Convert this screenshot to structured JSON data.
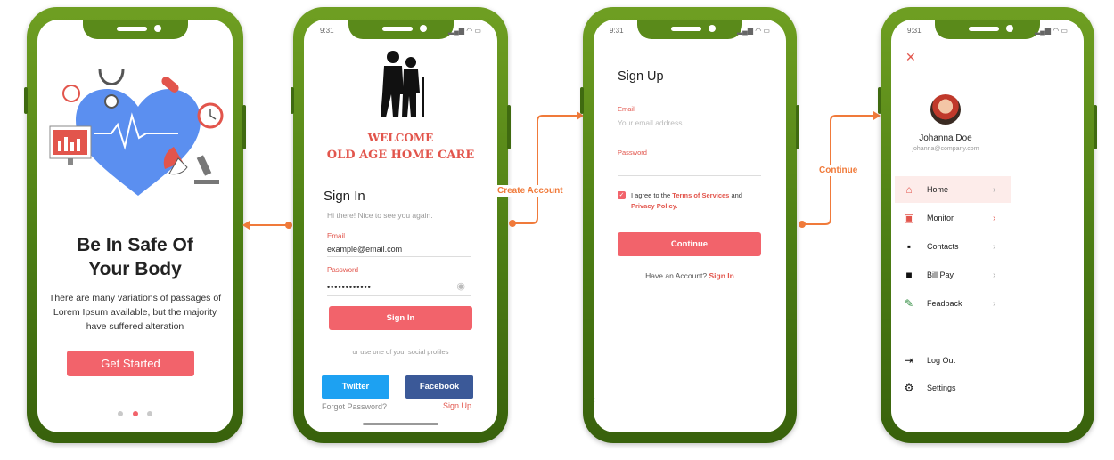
{
  "colors": {
    "accent": "#f2636b",
    "frame": "#5a8a1a",
    "connector": "#f07a3a",
    "twitter": "#1da1f2",
    "facebook": "#3b5998"
  },
  "status_time": "9:31",
  "connectors": {
    "create_account": "Create Account",
    "continue": "Continue"
  },
  "onboarding": {
    "title_line1": "Be In Safe Of",
    "title_line2": "Your Body",
    "description_line1": "There are many variations of passages of",
    "description_line2": "Lorem Ipsum available, but the majority",
    "description_line3": "have suffered alteration",
    "cta": "Get Started"
  },
  "signin": {
    "welcome": "WELCOME",
    "brand": "OLD AGE HOME CARE",
    "heading": "Sign In",
    "greeting": "Hi there! Nice to see you again.",
    "email_label": "Email",
    "email_value": "example@email.com",
    "password_label": "Password",
    "password_value": "••••••••••••",
    "submit": "Sign In",
    "social_hint": "or use one of your social profiles",
    "twitter": "Twitter",
    "facebook": "Facebook",
    "forgot": "Forgot Password?",
    "signup": "Sign Up"
  },
  "signup": {
    "heading": "Sign Up",
    "email_label": "Email",
    "email_placeholder": "Your email address",
    "password_label": "Password",
    "agree_prefix": "I agree to the",
    "terms": "Terms of Services",
    "and": "and",
    "privacy": "Privacy Policy.",
    "submit": "Continue",
    "have_account": "Have an Account?",
    "signin_link": "Sign In"
  },
  "menu": {
    "user_name": "Johanna Doe",
    "user_email": "johanna@company.com",
    "items": [
      {
        "label": "Home",
        "icon": "home-icon"
      },
      {
        "label": "Monitor",
        "icon": "monitor-icon"
      },
      {
        "label": "Contacts",
        "icon": "contacts-icon"
      },
      {
        "label": "Bill Pay",
        "icon": "bill-pay-icon"
      },
      {
        "label": "Feadback",
        "icon": "feedback-icon"
      }
    ],
    "logout": "Log Out",
    "settings": "Settings"
  }
}
